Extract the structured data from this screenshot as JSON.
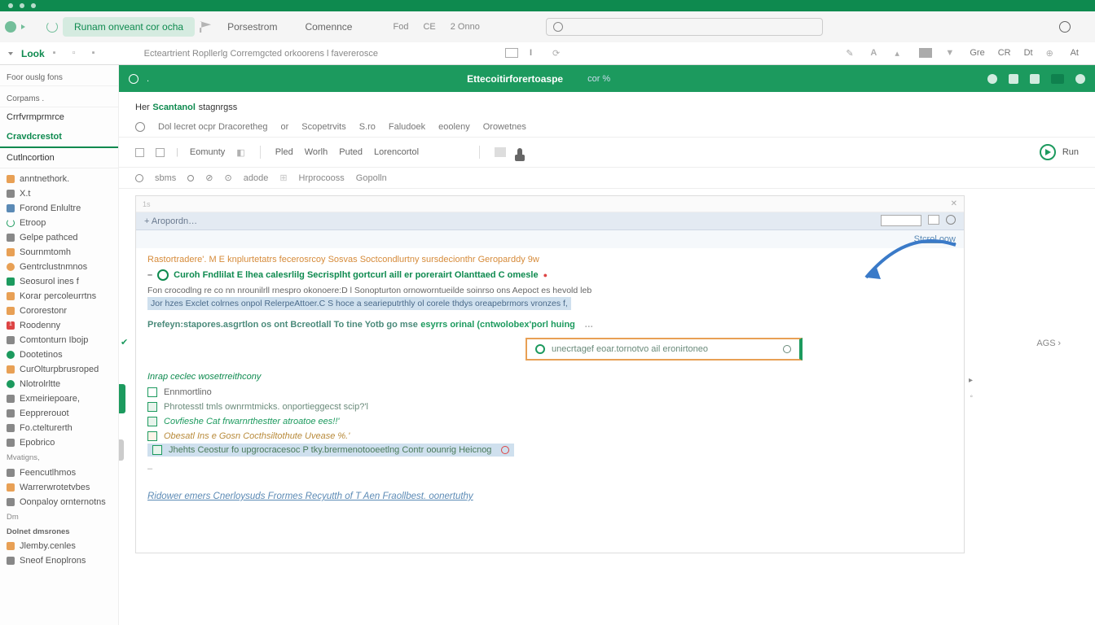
{
  "menubar": {
    "active_tab": "Runam onveant cor ocha",
    "items": [
      "Porsestrom",
      "Comennce"
    ],
    "center": [
      "Fod",
      "CE",
      "2 Onno"
    ]
  },
  "ribbon": {
    "look": "Look",
    "main": "Ecteartrient  Ropllerlg Corremgcted orkoorens l favererosce",
    "right_labels": [
      "Gre",
      "CR",
      "Dt",
      "At"
    ]
  },
  "greenbar": {
    "title": "Ettecoitirforertoaspe",
    "cor": "cor  %"
  },
  "section": {
    "pre": "Her",
    "bold": "Scantanol",
    "post": "stagnrgss"
  },
  "subtabs": [
    "Dol lecret ocpr Dracoretheg",
    "Scopetrvits",
    "S.ro",
    "Faludoek",
    "eooleny",
    "Orowetnes"
  ],
  "toolbar": {
    "items": [
      "Eomunty",
      "Pled",
      "Worlh",
      "Puted",
      "Lorencortol"
    ],
    "run": "Run"
  },
  "subtool": [
    "sbms",
    "adode",
    "Hrprocooss",
    "Gopolln"
  ],
  "editor": {
    "expand_label": "+ Aropordn…",
    "start_link": "Stcrol.oow",
    "orange1": "Rastortradere'. M E knplurtetatrs fecerosrcoy Sosvas Soctcondlurtny sursdecionthr Geroparddy  9w",
    "green_head": "Curoh Fndlilat E lhea calesrlilg Secrisplht gortcurl aill er porerairt Olanttaed C omesle",
    "desc": "Fon crocodlng re co nn nrounilrll rnespro okonoere:D l Sonopturton ornoworntueilde soinrso ons Aepoct es hevold leb",
    "highlight1": "Jor hzes Exclet colrnes onpol RelerpeAttoer.C S hoce a searieputrthly ol corele thdys oreapebrmors vronzes f,",
    "teal": "Prefeyn:stapores.asgrtlon os ont Bcreotlall To tine Yotb go mse",
    "teal_green": "esyrrs orinal (cntwolobex'porl huing",
    "orange_box": "unecrtagef eoar.tornotvo ail eronirtoneo",
    "sec2_title": "Inrap ceclec wosetrreithcony",
    "checks": [
      "Ennmortlino",
      "Phrotesstl tmls ownrmtmicks. onportieggecst scip?'l",
      "Covfieshe Cat frwarnrthestter atroatoe ees!!'",
      "Obesatl Ins e Gosn Cocthsiltothute Uvease %.'",
      "Jhehts Ceostur fo upgrocracesoc P tky.brermenotooeetlng Contr oounrig Heicnog"
    ],
    "bottom_link": "Ridower emers Cnerloysuds Frormes Recyutth of T Aen Fraollbest. oonertuthy",
    "side_badge": "AGS"
  },
  "sidebar": {
    "top_label": "Foor  ouslg  fons",
    "tabs_header": "Corpams .",
    "tab1": "Crrfvrmprmrce",
    "tab2": "Cravdcrestot",
    "tab3": "Cutlncortion",
    "items1": [
      "anntnethork.",
      "X.t",
      "Forond Enlultre",
      "Etroop",
      "Gelpe pathced",
      "Sournmtomh",
      "Gentrclustnmnos",
      "Seosurol ines f",
      "Korar percoleurrtns",
      "Cororestonr",
      "Roodenny",
      "Comtonturn Ibojp",
      "Dootetinos",
      "CurOlturpbrusroped",
      "Nlotrolrltte",
      "Exmeiriepoare,",
      "Eepprerouot",
      "Fo.ctelturerth",
      "Epobrico"
    ],
    "group2": "Mvatigns,",
    "items2": [
      "Feencutlhmos",
      "Warrerwrotetvbes",
      "Oonpaloy ornternotns"
    ],
    "group3": "Dm",
    "subhdr": "Dolnet dmsrones",
    "items3": [
      "Jlemby.cenles",
      "Sneof Enoplrons"
    ]
  }
}
